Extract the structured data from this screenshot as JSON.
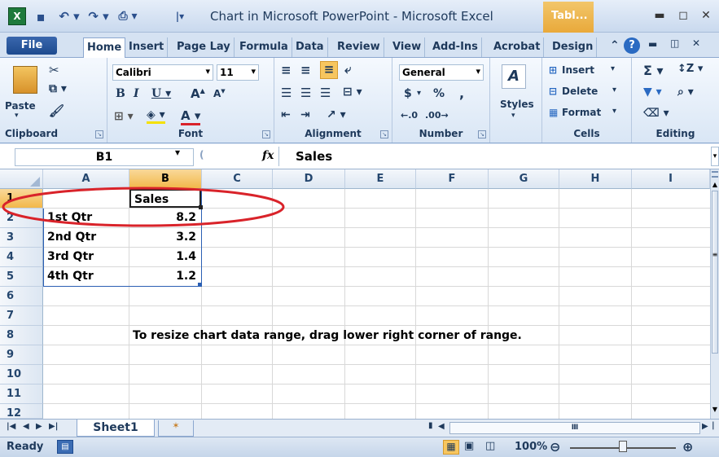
{
  "window": {
    "title": "Chart in Microsoft PowerPoint - Microsoft Excel",
    "context_tab": "Tabl...",
    "context_tab_sub": "Design"
  },
  "tabs": [
    "File",
    "Home",
    "Insert",
    "Page Lay",
    "Formula",
    "Data",
    "Review",
    "View",
    "Add-Ins",
    "Acrobat",
    "Design"
  ],
  "ribbon": {
    "clipboard": {
      "label": "Clipboard",
      "paste": "Paste"
    },
    "font": {
      "label": "Font",
      "name": "Calibri",
      "size": "11"
    },
    "alignment": {
      "label": "Alignment"
    },
    "number": {
      "label": "Number",
      "format": "General",
      "currency": "$",
      "percent": "%",
      "comma": ","
    },
    "styles": {
      "label": "Styles"
    },
    "cells": {
      "label": "Cells",
      "insert": "Insert",
      "delete": "Delete",
      "format": "Format"
    },
    "editing": {
      "label": "Editing"
    }
  },
  "formula_bar": {
    "name_box": "B1",
    "fx": "fx",
    "content": "Sales"
  },
  "columns": [
    "A",
    "B",
    "C",
    "D",
    "E",
    "F",
    "G",
    "H",
    "I"
  ],
  "rows": [
    "1",
    "2",
    "3",
    "4",
    "5",
    "6",
    "7",
    "8",
    "9",
    "10",
    "11",
    "12"
  ],
  "cells": {
    "B1": "Sales",
    "A2": "1st Qtr",
    "B2": "8.2",
    "A3": "2nd Qtr",
    "B3": "3.2",
    "A4": "3rd Qtr",
    "B4": "1.4",
    "A5": "4th Qtr",
    "B5": "1.2"
  },
  "note": "To resize chart data range, drag lower right corner of range.",
  "sheet_tab": "Sheet1",
  "status": {
    "mode": "Ready",
    "zoom": "100%"
  },
  "colors": {
    "accent": "#f2b84a",
    "annotation": "#d9232a",
    "selection": "#2b5fb3"
  }
}
